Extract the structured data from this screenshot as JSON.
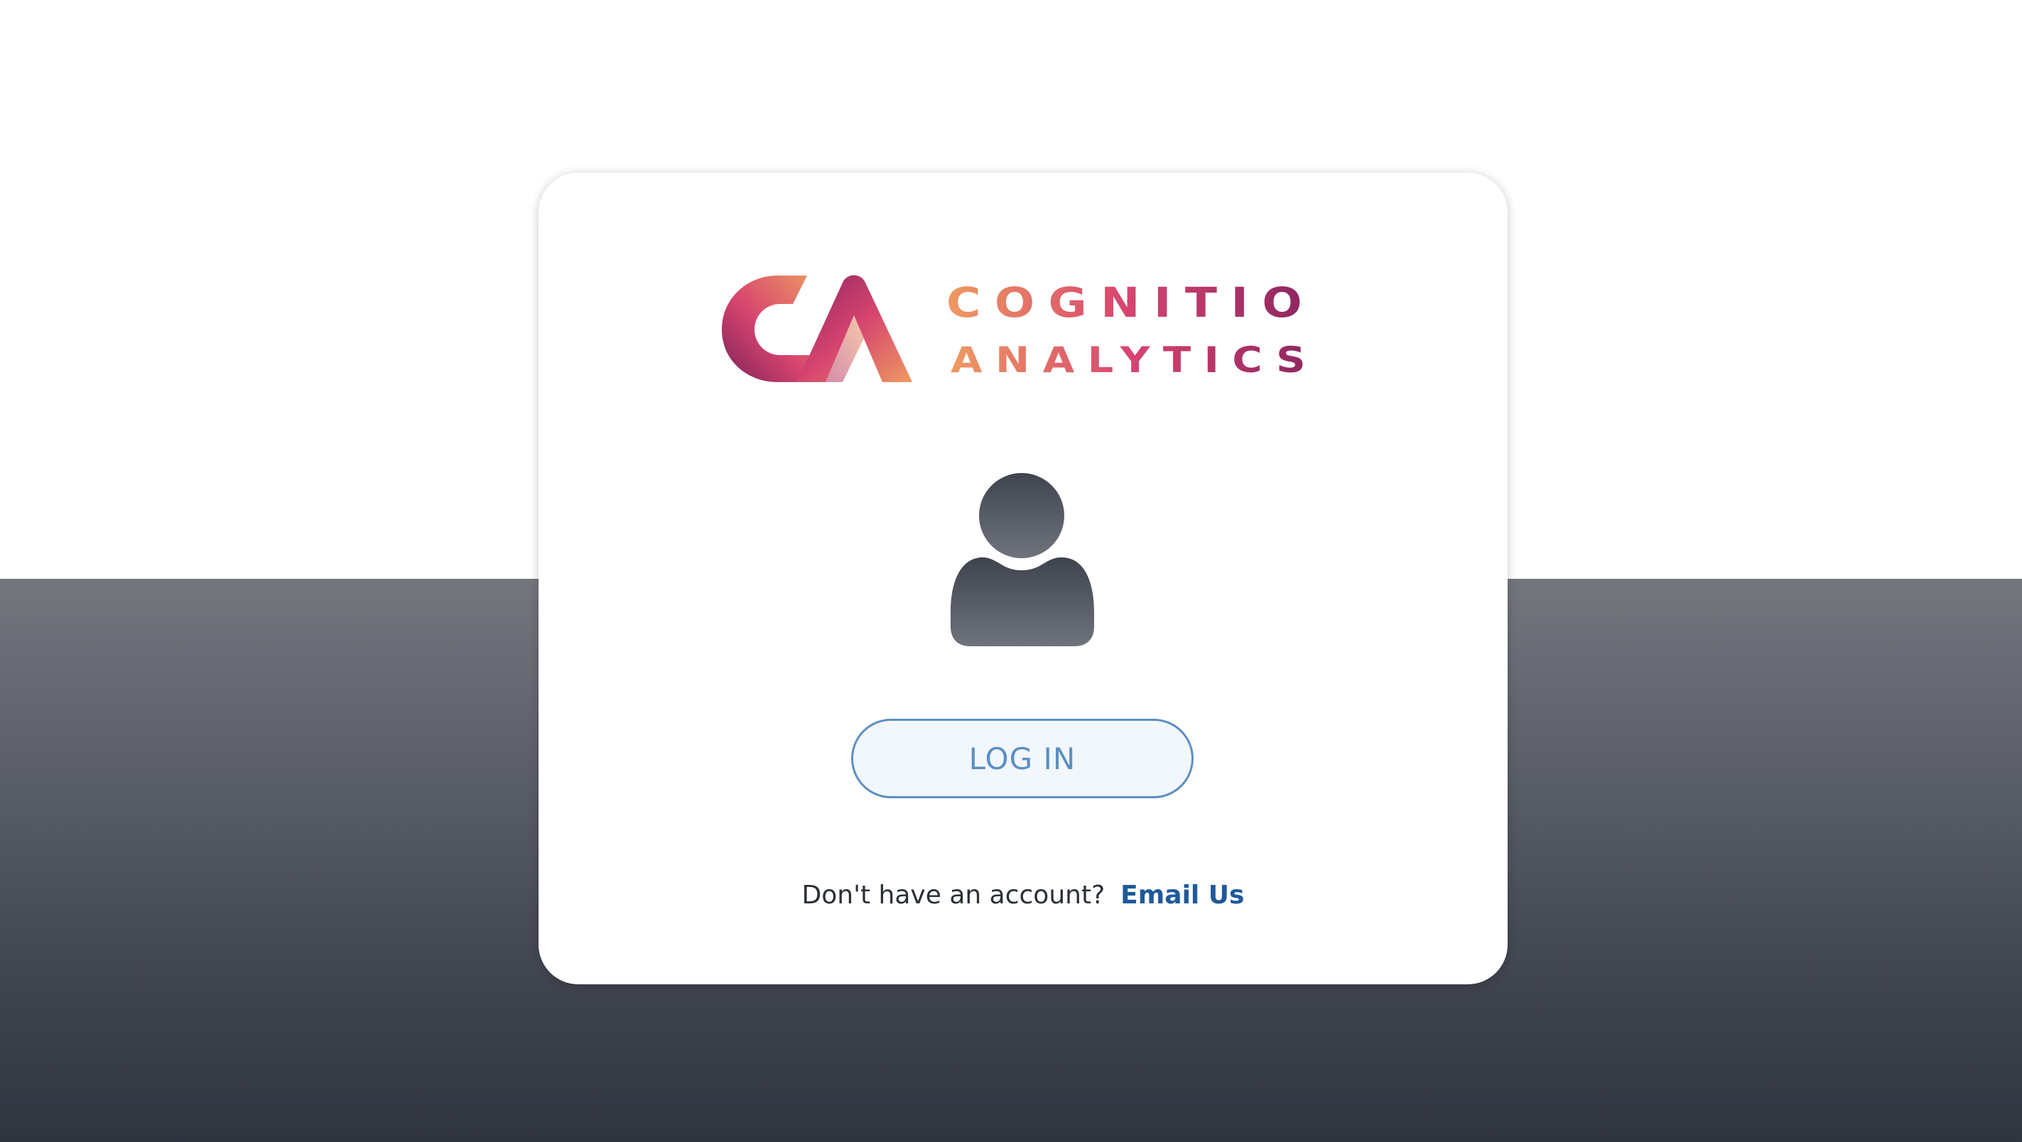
{
  "brand": {
    "logo_line1": "COGNITIO",
    "logo_line2": "ANALYTICS",
    "colors": {
      "orange": "#ee9a62",
      "pink": "#d6436f",
      "magenta": "#b12d6a",
      "plum": "#7a2257"
    }
  },
  "avatar": {
    "icon": "user-icon"
  },
  "login": {
    "button_label": "LOG IN",
    "accent": "#5d8fc2"
  },
  "signup": {
    "prompt": "Don't have an account?",
    "link_label": "Email Us",
    "link_color": "#1e5a9a"
  },
  "theme": {
    "background_top": "#ffffff",
    "background_bottom": "#303440"
  }
}
